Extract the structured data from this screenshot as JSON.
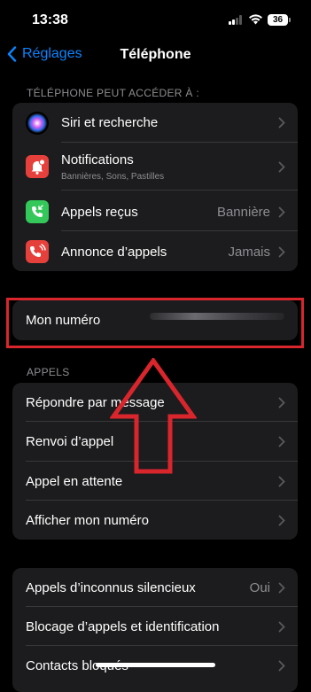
{
  "status": {
    "time": "13:38",
    "battery": "36"
  },
  "nav": {
    "back_label": "Réglages",
    "title": "Téléphone"
  },
  "access_section": {
    "header": "TÉLÉPHONE PEUT ACCÉDER À :",
    "rows": [
      {
        "label": "Siri et recherche",
        "icon": "siri-icon"
      },
      {
        "label": "Notifications",
        "subtitle": "Bannières, Sons, Pastilles",
        "icon": "notifications-icon"
      },
      {
        "label": "Appels reçus",
        "value": "Bannière",
        "icon": "incoming-calls-icon"
      },
      {
        "label": "Annonce d’appels",
        "value": "Jamais",
        "icon": "announce-calls-icon"
      }
    ]
  },
  "my_number": {
    "label": "Mon numéro"
  },
  "calls_section": {
    "header": "APPELS",
    "rows": [
      {
        "label": "Répondre par message"
      },
      {
        "label": "Renvoi d’appel"
      },
      {
        "label": "Appel en attente"
      },
      {
        "label": "Afficher mon numéro"
      }
    ]
  },
  "blocking_section": {
    "rows": [
      {
        "label": "Appels d’inconnus silencieux",
        "value": "Oui"
      },
      {
        "label": "Blocage d’appels et identification"
      },
      {
        "label": "Contacts bloqués"
      }
    ]
  },
  "colors": {
    "accent": "#0a84ff",
    "highlight": "#d9252c",
    "cell": "#1c1c1e",
    "secondary_text": "#8e8e93"
  }
}
